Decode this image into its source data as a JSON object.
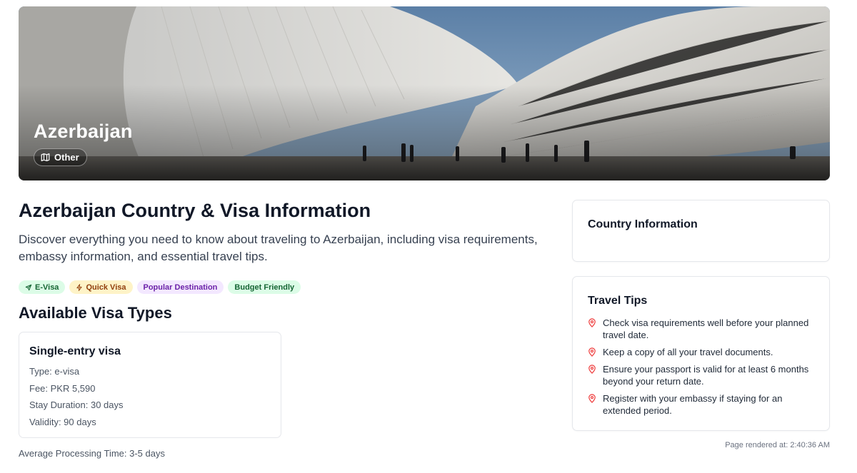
{
  "hero": {
    "title": "Azerbaijan",
    "badge_label": "Other",
    "badge_icon": "map-icon"
  },
  "main": {
    "title": "Azerbaijan Country & Visa Information",
    "intro": "Discover everything you need to know about traveling to Azerbaijan, including visa requirements, embassy information, and essential travel tips.",
    "tags": [
      {
        "label": "E-Visa",
        "icon": "plane-icon",
        "color": "#166534",
        "bg": "#dcfce7"
      },
      {
        "label": "Quick Visa",
        "icon": "lightning-icon",
        "color": "#92400e",
        "bg": "#fef3c7"
      },
      {
        "label": "Popular Destination",
        "color": "#6b21a8",
        "bg": "#f3e8ff"
      },
      {
        "label": "Budget Friendly",
        "color": "#166534",
        "bg": "#dcfce7"
      }
    ],
    "section_title": "Available Visa Types",
    "visa": {
      "name": "Single-entry visa",
      "type": "Type: e-visa",
      "fee": "Fee: PKR 5,590",
      "stay": "Stay Duration: 30 days",
      "validity": "Validity: 90 days"
    },
    "avg_processing": "Average Processing Time: 3-5 days"
  },
  "sidebar": {
    "country_info_title": "Country Information",
    "tips_title": "Travel Tips",
    "tip_icon": "map-pin-icon",
    "tips": [
      "Check visa requirements well before your planned travel date.",
      "Keep a copy of all your travel documents.",
      "Ensure your passport is valid for at least 6 months beyond your return date.",
      "Register with your embassy if staying for an extended period."
    ]
  },
  "footer": {
    "rendered": "Page rendered at: 2:40:36 AM"
  },
  "colors": {
    "pin": "#ef4444",
    "text_primary": "#111827",
    "text_secondary": "#4b5563"
  }
}
